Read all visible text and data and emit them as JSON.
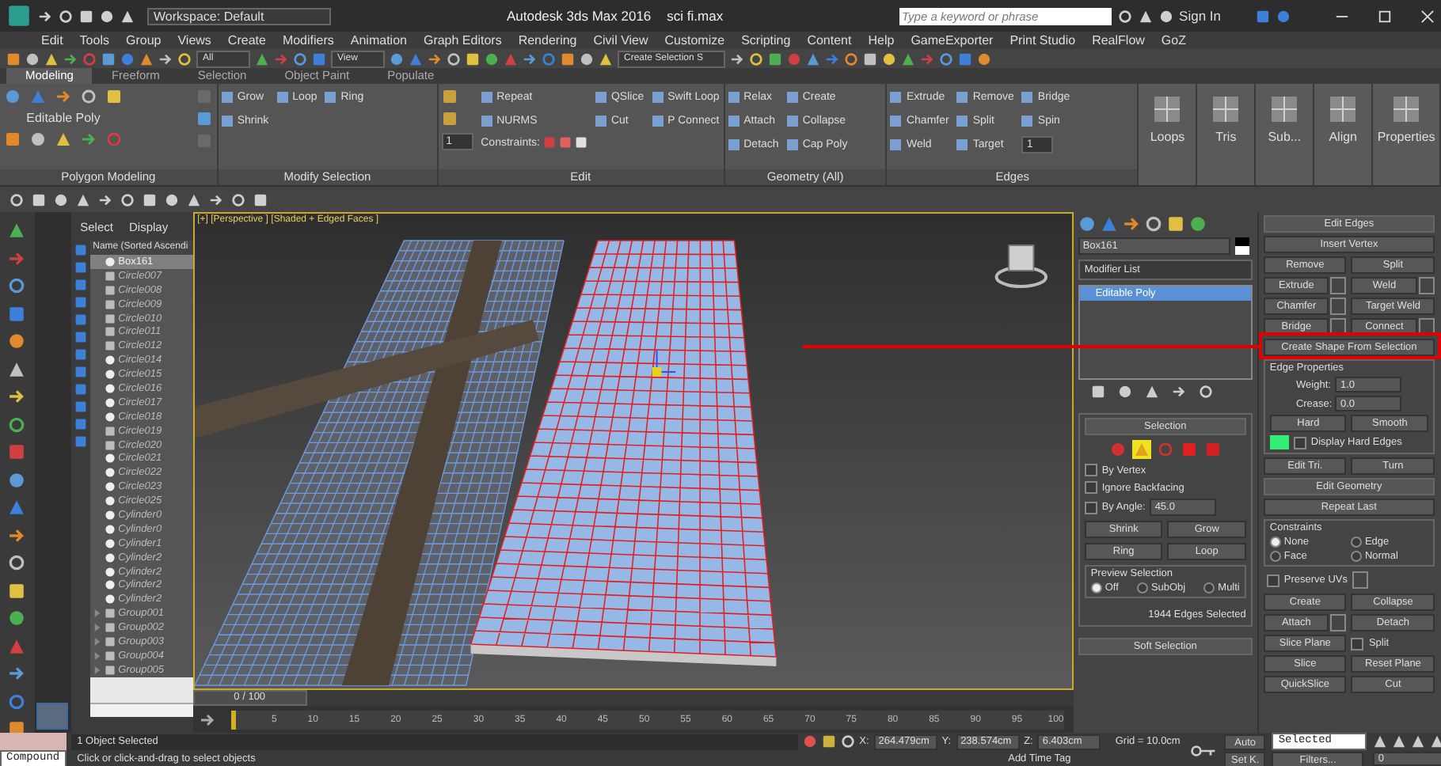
{
  "title_bar": {
    "workspace": "Workspace: Default",
    "title": "Autodesk 3ds Max 2016",
    "file": "sci fi.max",
    "search": {
      "placeholder": "Type a keyword or phrase"
    },
    "sign_in": "Sign In"
  },
  "menu": [
    "Edit",
    "Tools",
    "Group",
    "Views",
    "Create",
    "Modifiers",
    "Animation",
    "Graph Editors",
    "Rendering",
    "Civil View",
    "Customize",
    "Scripting",
    "Content",
    "Help",
    "GameExporter",
    "Print Studio",
    "RealFlow",
    "GoZ"
  ],
  "main_toolbar": {
    "filter": "All",
    "coordinate": "View",
    "selection_set": "Create Selection S"
  },
  "ribbon": {
    "tabs": [
      {
        "label": "Modeling",
        "selected": true
      },
      {
        "label": "Freeform",
        "selected": false
      },
      {
        "label": "Selection",
        "selected": false
      },
      {
        "label": "Object Paint",
        "selected": false
      },
      {
        "label": "Populate",
        "selected": false
      }
    ],
    "panels": [
      {
        "kind": "poly",
        "title": "Polygon Modeling",
        "label": "Editable Poly"
      },
      {
        "kind": "grid",
        "title": "Modify Selection",
        "columns": [
          [
            {
              "label": "Grow",
              "kind": "button"
            },
            {
              "label": "Shrink",
              "kind": "button"
            }
          ],
          [
            {
              "label": "Loop",
              "kind": "button"
            }
          ],
          [
            {
              "label": "Ring",
              "kind": "button"
            }
          ]
        ]
      },
      {
        "kind": "grid",
        "title": "Edit",
        "spinner": "1",
        "columns": [
          [
            {
              "label": "Repeat",
              "kind": "button"
            },
            {
              "label": "NURMS",
              "kind": "button"
            },
            {
              "label": "Constraints:",
              "kind": "constraints"
            }
          ],
          [
            {
              "label": "QSlice",
              "kind": "button"
            },
            {
              "label": "Cut",
              "kind": "button"
            }
          ],
          [
            {
              "label": "Swift Loop",
              "kind": "button"
            },
            {
              "label": "P Connect",
              "kind": "button"
            }
          ]
        ]
      },
      {
        "kind": "grid",
        "title": "Geometry (All)",
        "columns": [
          [
            {
              "label": "Relax",
              "kind": "button"
            },
            {
              "label": "Attach",
              "kind": "button"
            },
            {
              "label": "Detach",
              "kind": "button"
            }
          ],
          [
            {
              "label": "Create",
              "kind": "button"
            },
            {
              "label": "Collapse",
              "kind": "button"
            },
            {
              "label": "Cap Poly",
              "kind": "button"
            }
          ]
        ]
      },
      {
        "kind": "grid",
        "title": "Edges",
        "columns": [
          [
            {
              "label": "Extrude",
              "kind": "button"
            },
            {
              "label": "Chamfer",
              "kind": "button"
            },
            {
              "label": "Weld",
              "kind": "button"
            }
          ],
          [
            {
              "label": "Remove",
              "kind": "button"
            },
            {
              "label": "Split",
              "kind": "button"
            },
            {
              "label": "Target",
              "kind": "button"
            }
          ],
          [
            {
              "label": "Bridge",
              "kind": "button"
            },
            {
              "label": "Spin",
              "kind": "button"
            },
            {
              "label": "1",
              "kind": "spinner"
            }
          ]
        ]
      },
      {
        "kind": "big",
        "title": "Loops"
      },
      {
        "kind": "big",
        "title": "Tris"
      },
      {
        "kind": "big",
        "title": "Sub..."
      },
      {
        "kind": "big",
        "title": "Align"
      },
      {
        "kind": "big",
        "title": "Properties"
      }
    ]
  },
  "scene_explorer": {
    "tabs": [
      "Select",
      "Display"
    ],
    "column": "Name (Sorted Ascendi",
    "items": [
      {
        "name": "Box161",
        "kind": "mesh",
        "selected": true
      },
      {
        "name": "Circle007",
        "kind": "shape",
        "selected": false
      },
      {
        "name": "Circle008",
        "kind": "shape",
        "selected": false
      },
      {
        "name": "Circle009",
        "kind": "shape",
        "selected": false
      },
      {
        "name": "Circle010",
        "kind": "shape",
        "selected": false
      },
      {
        "name": "Circle011",
        "kind": "shape",
        "selected": false
      },
      {
        "name": "Circle012",
        "kind": "shape",
        "selected": false
      },
      {
        "name": "Circle014",
        "kind": "mesh",
        "selected": false
      },
      {
        "name": "Circle015",
        "kind": "mesh",
        "selected": false
      },
      {
        "name": "Circle016",
        "kind": "mesh",
        "selected": false
      },
      {
        "name": "Circle017",
        "kind": "mesh",
        "selected": false
      },
      {
        "name": "Circle018",
        "kind": "mesh",
        "selected": false
      },
      {
        "name": "Circle019",
        "kind": "shape",
        "selected": false
      },
      {
        "name": "Circle020",
        "kind": "shape",
        "selected": false
      },
      {
        "name": "Circle021",
        "kind": "mesh",
        "selected": false
      },
      {
        "name": "Circle022",
        "kind": "mesh",
        "selected": false
      },
      {
        "name": "Circle023",
        "kind": "mesh",
        "selected": false
      },
      {
        "name": "Circle025",
        "kind": "mesh",
        "selected": false
      },
      {
        "name": "Cylinder0",
        "kind": "mesh",
        "selected": false
      },
      {
        "name": "Cylinder0",
        "kind": "mesh",
        "selected": false
      },
      {
        "name": "Cylinder1",
        "kind": "mesh",
        "selected": false
      },
      {
        "name": "Cylinder2",
        "kind": "mesh",
        "selected": false
      },
      {
        "name": "Cylinder2",
        "kind": "mesh",
        "selected": false
      },
      {
        "name": "Cylinder2",
        "kind": "mesh",
        "selected": false
      },
      {
        "name": "Cylinder2",
        "kind": "mesh",
        "selected": false
      },
      {
        "name": "Group001",
        "kind": "group",
        "selected": false
      },
      {
        "name": "Group002",
        "kind": "group",
        "selected": false
      },
      {
        "name": "Group003",
        "kind": "group",
        "selected": false
      },
      {
        "name": "Group004",
        "kind": "group",
        "selected": false
      },
      {
        "name": "Group005",
        "kind": "group",
        "selected": false
      }
    ]
  },
  "viewport": {
    "label": "[+] [Perspective ] [Shaded + Edged Faces ]"
  },
  "timeline": {
    "position": "0 / 100",
    "level": 0,
    "ticks": [
      "5",
      "10",
      "15",
      "20",
      "25",
      "30",
      "35",
      "40",
      "45",
      "50",
      "55",
      "60",
      "65",
      "70",
      "75",
      "80",
      "85",
      "90",
      "95",
      "100"
    ]
  },
  "command_panel": {
    "object_name": "Box161",
    "modifier_list": "Modifier List",
    "stack": [
      {
        "label": "Editable Poly",
        "selected": true
      }
    ],
    "selection": {
      "title": "Selection",
      "levels": [
        {
          "selected": false
        },
        {
          "selected": true
        },
        {
          "selected": false
        },
        {
          "selected": false
        },
        {
          "selected": false
        }
      ],
      "options": [
        {
          "label": "By Vertex",
          "checked": false
        },
        {
          "label": "Ignore Backfacing",
          "checked": false
        },
        {
          "label": "By Angle:",
          "checked": false,
          "value": "45.0"
        }
      ],
      "buttons": [
        "Shrink",
        "Grow"
      ],
      "spin_buttons": [
        "Ring",
        "Loop"
      ],
      "preview": {
        "title": "Preview Selection",
        "options": [
          {
            "label": "Off",
            "selected": true
          },
          {
            "label": "SubObj",
            "selected": false
          },
          {
            "label": "Multi",
            "selected": false
          }
        ]
      },
      "info": "1944 Edges Selected"
    },
    "soft_selection": "Soft Selection"
  },
  "edit_edges": {
    "title": "Edit Edges",
    "insert": "Insert Vertex",
    "buttons": [
      {
        "label": "Remove",
        "settings": false
      },
      {
        "label": "Split",
        "settings": false
      },
      {
        "label": "Extrude",
        "settings": true
      },
      {
        "label": "Weld",
        "settings": true
      },
      {
        "label": "Chamfer",
        "settings": true
      },
      {
        "label": "Target Weld",
        "settings": false
      },
      {
        "label": "Bridge",
        "settings": true
      },
      {
        "label": "Connect",
        "settings": true
      }
    ],
    "create_shape": "Create Shape From Selection",
    "properties": {
      "title": "Edge Properties",
      "fields": [
        {
          "label": "Weight:",
          "value": "1.0"
        },
        {
          "label": "Crease:",
          "value": "0.0"
        }
      ],
      "buttons": [
        "Hard",
        "Smooth"
      ],
      "display_hard": {
        "label": "Display Hard Edges",
        "checked": false
      }
    },
    "buttons2": [
      "Edit Tri.",
      "Turn"
    ]
  },
  "edit_geometry": {
    "title": "Edit Geometry",
    "repeat": "Repeat Last",
    "constraints": {
      "title": "Constraints",
      "options": [
        {
          "label": "None",
          "selected": true
        },
        {
          "label": "Edge",
          "selected": false
        },
        {
          "label": "Face",
          "selected": false
        },
        {
          "label": "Normal",
          "selected": false
        }
      ]
    },
    "preserve": {
      "label": "Preserve UVs",
      "checked": false
    },
    "buttons": [
      {
        "label": "Create",
        "settings": false
      },
      {
        "label": "Collapse",
        "settings": false
      },
      {
        "label": "Attach",
        "settings": true
      },
      {
        "label": "Detach",
        "settings": false
      }
    ],
    "slice": {
      "label": "Slice Plane",
      "split": {
        "label": "Split",
        "checked": false
      }
    },
    "buttons2": [
      "Slice",
      "Reset Plane",
      "QuickSlice",
      "Cut"
    ]
  },
  "status_bar": {
    "mode": "Compound",
    "selected": "1 Object Selected",
    "prompt": "Click or click-and-drag to select objects",
    "coords": [
      {
        "label": "X:",
        "value": "264.479cm"
      },
      {
        "label": "Y:",
        "value": "238.574cm"
      },
      {
        "label": "Z:",
        "value": "6.403cm"
      }
    ],
    "grid": "Grid = 10.0cm",
    "time_tag": "Add Time Tag",
    "auto": "Auto",
    "set_key": "Set K.",
    "key_filter": "Selected",
    "filters": "Filters...",
    "frame": "0"
  }
}
